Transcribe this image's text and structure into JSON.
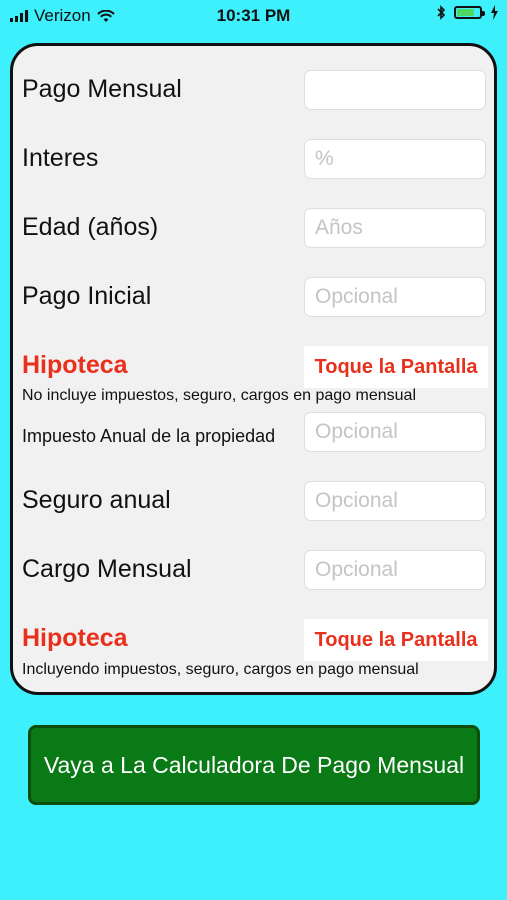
{
  "status_bar": {
    "carrier": "Verizon",
    "time": "10:31 PM",
    "battery_level": 0.75
  },
  "form": {
    "rows": [
      {
        "label": "Pago Mensual",
        "placeholder": ""
      },
      {
        "label": "Interes",
        "placeholder": "%"
      },
      {
        "label": "Edad (años)",
        "placeholder": "Años"
      },
      {
        "label": "Pago Inicial",
        "placeholder": "Opcional"
      }
    ],
    "result1": {
      "title": "Hipoteca",
      "action": "Toque la Pantalla",
      "note": "No incluye impuestos, seguro, cargos en pago mensual"
    },
    "rows2": [
      {
        "label": "Impuesto Anual de la propiedad",
        "placeholder": "Opcional"
      },
      {
        "label": "Seguro anual",
        "placeholder": "Opcional"
      },
      {
        "label": "Cargo Mensual",
        "placeholder": "Opcional"
      }
    ],
    "result2": {
      "title": "Hipoteca",
      "action": "Toque la Pantalla",
      "note": "Incluyendo impuestos, seguro, cargos en pago mensual"
    }
  },
  "go_button_label": "Vaya a La Calculadora De Pago Mensual",
  "colors": {
    "background": "#3ef0fb",
    "accent_red": "#e8301c",
    "button_green": "#0a7a16"
  }
}
